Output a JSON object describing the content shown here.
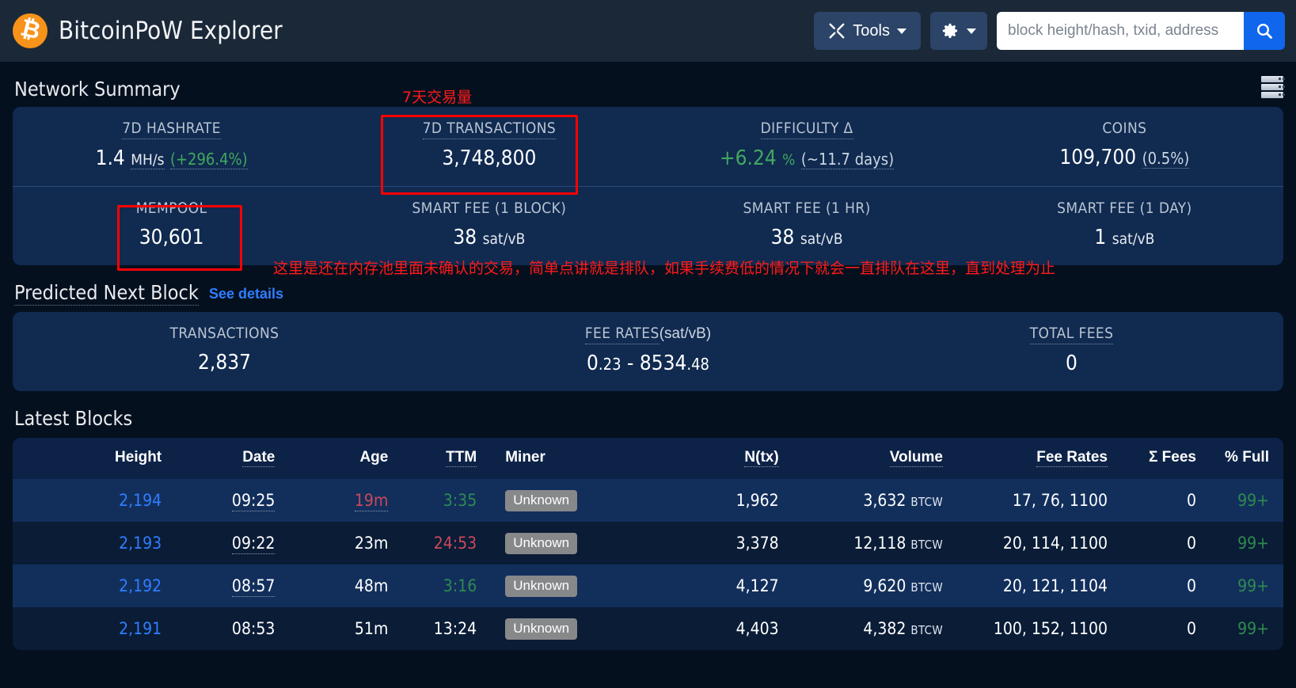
{
  "header": {
    "brand": "BitcoinPoW Explorer",
    "logo_glyph": "₿",
    "tools_label": "Tools",
    "search_placeholder": "block height/hash, txid, address",
    "search_value": ""
  },
  "network_summary": {
    "title": "Network Summary",
    "row1": [
      {
        "label": "7D HASHRATE",
        "value": "1.4",
        "unit": "MH/s",
        "sub": "(+296.4%)",
        "sub_color": "green"
      },
      {
        "label": "7D TRANSACTIONS",
        "value": "3,748,800",
        "unit": "",
        "sub": ""
      },
      {
        "label": "DIFFICULTY Δ",
        "value": "+6.24",
        "unit": "%",
        "sub": "(~11.7 days)",
        "value_color": "green"
      },
      {
        "label": "COINS",
        "value": "109,700",
        "unit": "",
        "sub": "(0.5%)"
      }
    ],
    "row2": [
      {
        "label": "MEMPOOL",
        "value": "30,601",
        "unit": "",
        "sub": ""
      },
      {
        "label": "SMART FEE (1 BLOCK)",
        "value": "38",
        "unit": "sat/vB",
        "sub": ""
      },
      {
        "label": "SMART FEE (1 HR)",
        "value": "38",
        "unit": "sat/vB",
        "sub": ""
      },
      {
        "label": "SMART FEE (1 DAY)",
        "value": "1",
        "unit": "sat/vB",
        "sub": ""
      }
    ]
  },
  "predicted_next_block": {
    "title": "Predicted Next Block",
    "see_details": "See details",
    "stats": [
      {
        "label": "TRANSACTIONS",
        "value": "2,837",
        "unit": "",
        "sub": ""
      },
      {
        "label": "FEE RATES",
        "unit_suffix": "(sat/vB)",
        "value_lo": "0",
        "value_lo_dec": ".23",
        "dash": "-",
        "value_hi": "8534",
        "value_hi_dec": ".48"
      },
      {
        "label": "TOTAL FEES",
        "value": "0",
        "unit": "",
        "sub": ""
      }
    ]
  },
  "latest_blocks": {
    "title": "Latest Blocks",
    "columns": [
      "Height",
      "Date",
      "Age",
      "TTM",
      "Miner",
      "N(tx)",
      "Volume",
      "Fee Rates",
      "Σ Fees",
      "% Full"
    ],
    "rows": [
      {
        "height": "2,194",
        "date": "09:25",
        "age": "19m",
        "age_color": "red",
        "ttm": "3:35",
        "ttm_color": "green",
        "miner": "Unknown",
        "ntx": "1,962",
        "volume": "3,632",
        "volume_unit": "BTCW",
        "fee_rates": "17, 76, 1100",
        "fees": "0",
        "pct_full": "99+"
      },
      {
        "height": "2,193",
        "date": "09:22",
        "age": "23m",
        "age_color": "white",
        "ttm": "24:53",
        "ttm_color": "red",
        "miner": "Unknown",
        "ntx": "3,378",
        "volume": "12,118",
        "volume_unit": "BTCW",
        "fee_rates": "20, 114, 1100",
        "fees": "0",
        "pct_full": "99+"
      },
      {
        "height": "2,192",
        "date": "08:57",
        "age": "48m",
        "age_color": "white",
        "ttm": "3:16",
        "ttm_color": "green",
        "miner": "Unknown",
        "ntx": "4,127",
        "volume": "9,620",
        "volume_unit": "BTCW",
        "fee_rates": "20, 121, 1104",
        "fees": "0",
        "pct_full": "99+"
      },
      {
        "height": "2,191",
        "date": "08:53",
        "age": "51m",
        "age_color": "white",
        "ttm": "13:24",
        "ttm_color": "white",
        "miner": "Unknown",
        "ntx": "4,403",
        "volume": "4,382",
        "volume_unit": "BTCW",
        "fee_rates": "100, 152, 1100",
        "fees": "0",
        "pct_full": "99+"
      }
    ]
  },
  "annotations": {
    "tx_label": "7天交易量",
    "mempool_note": "这里是还在内存池里面未确认的交易，简单点讲就是排队，如果手续费低的情况下就会一直排队在这里，直到处理为止"
  },
  "colors": {
    "accent_blue": "#2f7eff",
    "brand_orange": "#f7931a",
    "annotation_red": "#ff0000",
    "green": "#41a85f"
  }
}
